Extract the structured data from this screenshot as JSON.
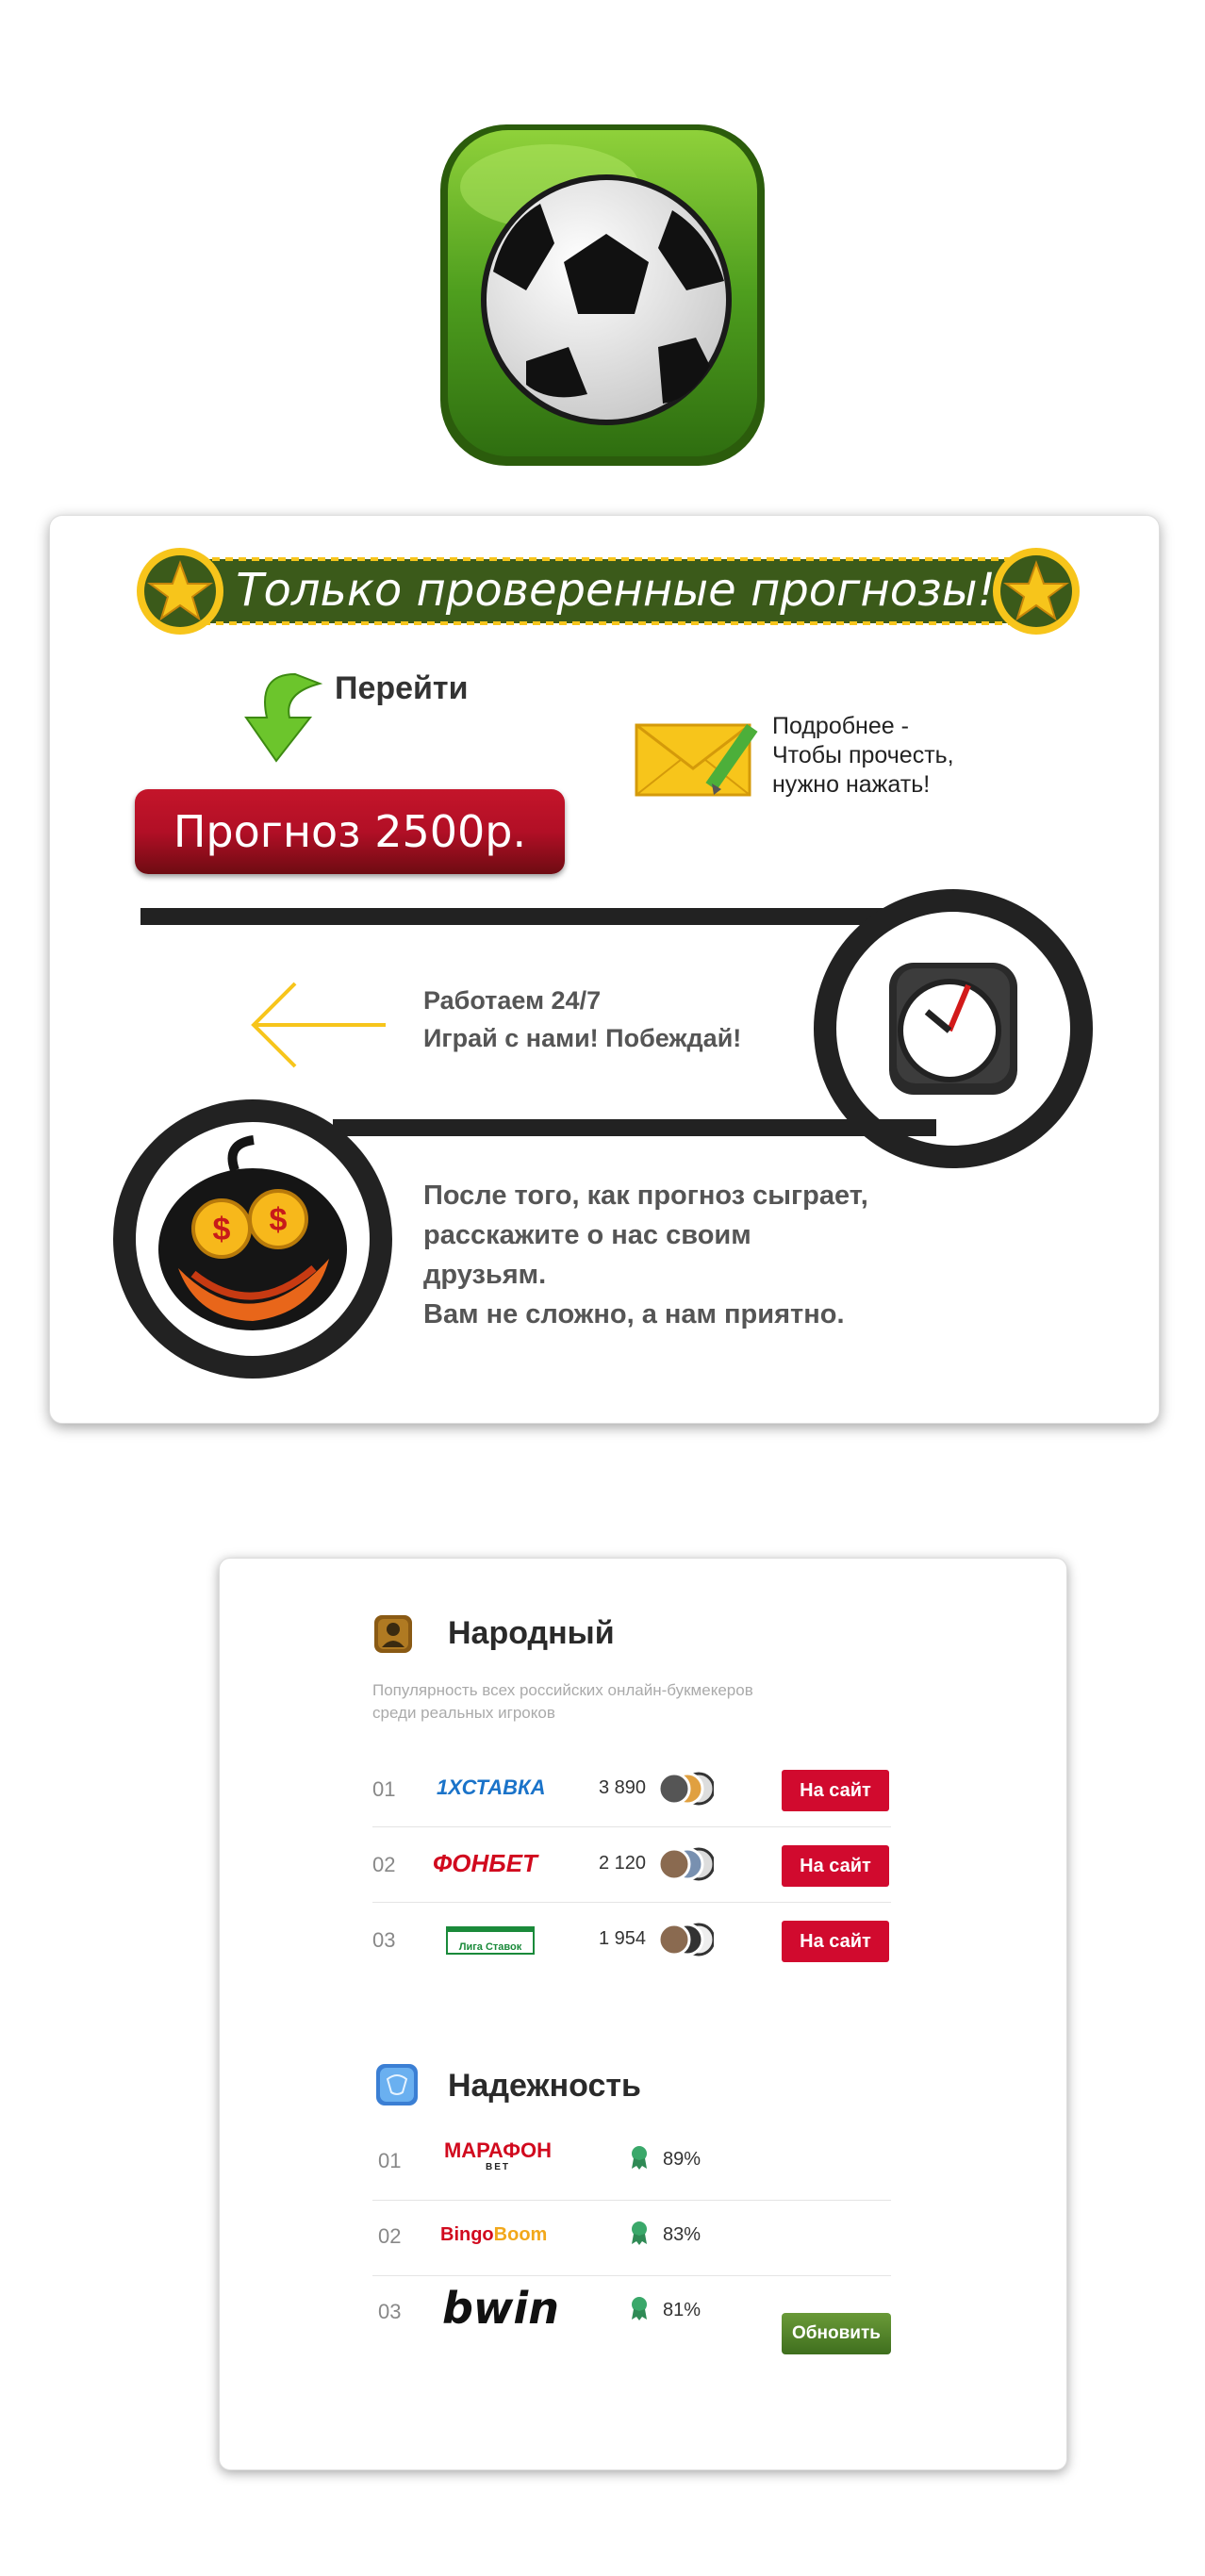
{
  "card1": {
    "banner_text": "Только проверенные прогнозы!",
    "go_label": "Перейти",
    "forecast_button": "Прогноз 2500р.",
    "details": [
      "Подробнее -",
      "Чтобы прочесть,",
      "нужно нажать!"
    ],
    "work_lines": [
      "Работаем 24/7",
      "Играй с нами! Побеждай!"
    ],
    "after_lines": [
      "После того, как прогноз сыграет,",
      "расскажите о нас своим",
      "друзьям.",
      "Вам не сложно, а нам приятно."
    ]
  },
  "card2": {
    "popular": {
      "title": "Народный",
      "subtitle_lines": [
        "Популярность всех российских онлайн-букмекеров",
        "среди реальных игроков"
      ],
      "rows": [
        {
          "num": "01",
          "brand": "1ХСТАВКА",
          "count": "3 890",
          "button": "На сайт"
        },
        {
          "num": "02",
          "brand": "ФОНБЕТ",
          "count": "2 120",
          "button": "На сайт"
        },
        {
          "num": "03",
          "brand": "Лига Ставок",
          "count": "1 954",
          "button": "На сайт"
        }
      ]
    },
    "reliability": {
      "title": "Надежность",
      "rows": [
        {
          "num": "01",
          "brand": "МАРАФОН",
          "brand_sub": "BET",
          "pct": "89%"
        },
        {
          "num": "02",
          "brand_a": "Bingo",
          "brand_b": "Boom",
          "pct": "83%"
        },
        {
          "num": "03",
          "brand": "bwin",
          "pct": "81%"
        }
      ],
      "update_button": "Обновить"
    }
  },
  "colors": {
    "accent_red": "#d10a2e",
    "banner_green": "#3b5a1a",
    "star_yellow": "#f7c51b",
    "update_green": "#4f8326"
  }
}
